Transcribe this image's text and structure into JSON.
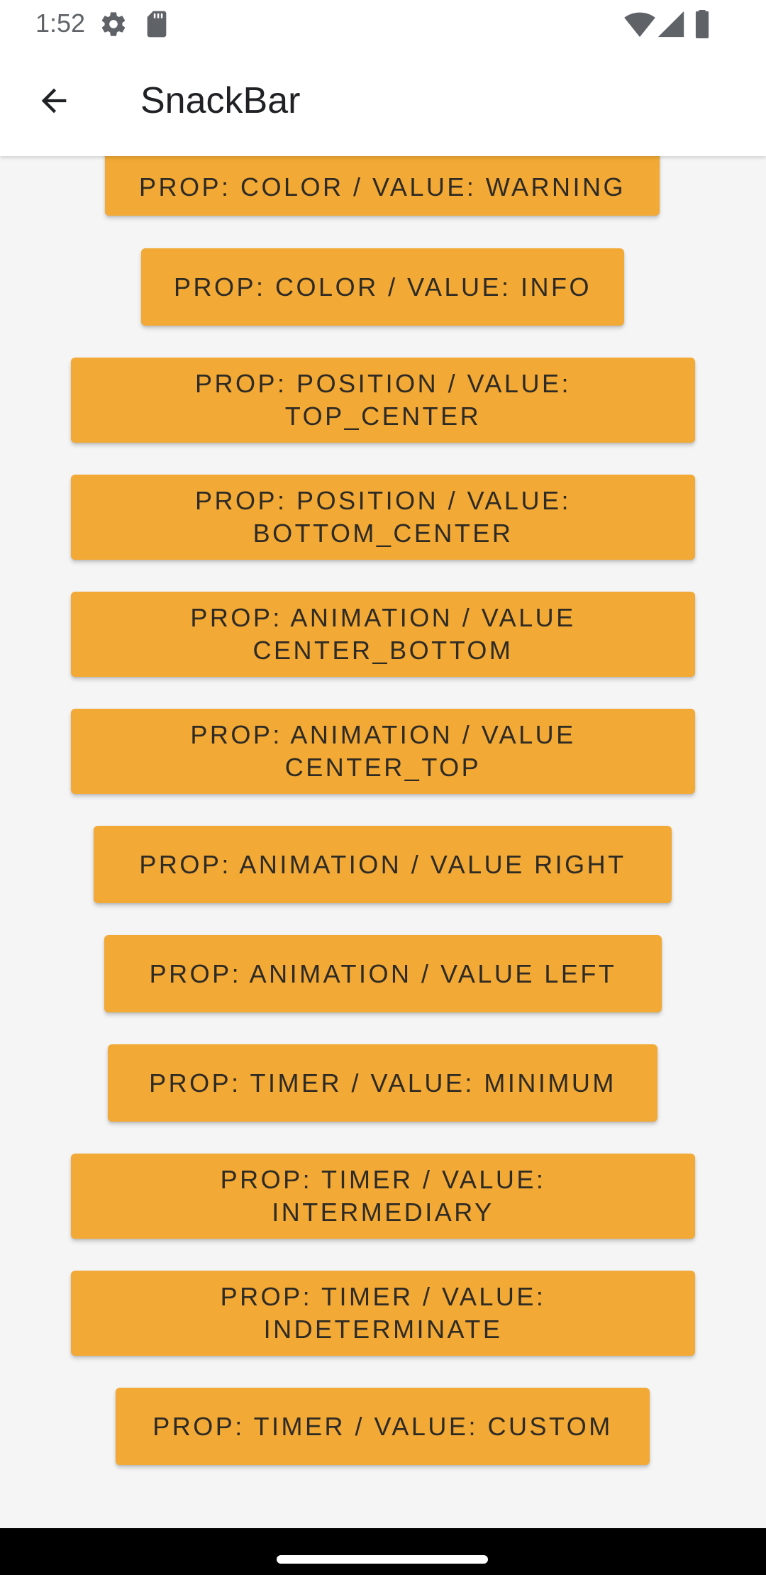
{
  "status_bar": {
    "time": "1:52",
    "icons": [
      "settings-icon",
      "sd-card-icon",
      "wifi-icon",
      "signal-icon",
      "battery-icon"
    ]
  },
  "app_bar": {
    "title": "SnackBar",
    "back_icon": "arrow-back-icon"
  },
  "buttons": [
    {
      "label": "PROP: COLOR / VALUE: WARNING"
    },
    {
      "label": "PROP: COLOR / VALUE: INFO"
    },
    {
      "label": "PROP: POSITION / VALUE:\nTOP_CENTER"
    },
    {
      "label": "PROP: POSITION / VALUE:\nBOTTOM_CENTER"
    },
    {
      "label": "PROP: ANIMATION / VALUE\nCENTER_BOTTOM"
    },
    {
      "label": "PROP: ANIMATION / VALUE\nCENTER_TOP"
    },
    {
      "label": "PROP: ANIMATION / VALUE  RIGHT"
    },
    {
      "label": "PROP: ANIMATION / VALUE  LEFT"
    },
    {
      "label": "PROP: TIMER / VALUE: MINIMUM"
    },
    {
      "label": "PROP: TIMER / VALUE:\nINTERMEDIARY"
    },
    {
      "label": "PROP: TIMER / VALUE:\nINDETERMINATE"
    },
    {
      "label": "PROP: TIMER / VALUE: CUSTOM"
    }
  ],
  "colors": {
    "button": "#f2a935",
    "button_text": "#2e2a24",
    "background": "#f5f5f5",
    "app_bar": "#ffffff"
  }
}
